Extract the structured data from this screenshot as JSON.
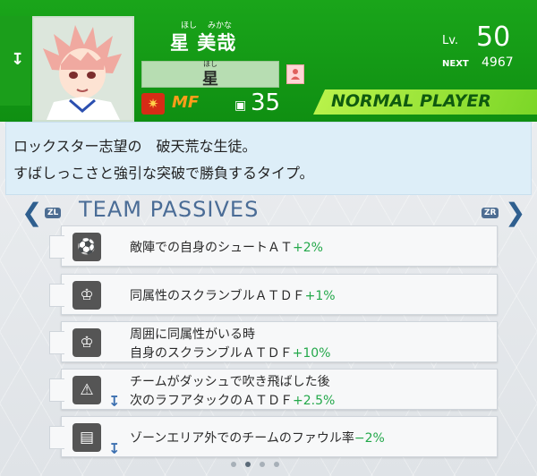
{
  "player": {
    "name": "星 美哉",
    "name_furigana_left": "ほし",
    "name_furigana_right": "みかな",
    "nickname": "星",
    "nickname_furigana": "ほし",
    "position": "MF",
    "power": "35",
    "level_label": "Lv.",
    "level": "50",
    "next_label": "NEXT",
    "next_exp": "4967",
    "rank": "NORMAL PLAYER"
  },
  "description": {
    "line1": "ロックスター志望の　破天荒な生徒。",
    "line2": "すばしっこさと強引な突破で勝負するタイプ。"
  },
  "team_passives": {
    "title": "TEAM PASSIVES",
    "left_button": "ZL",
    "right_button": "ZR",
    "items": [
      {
        "icon": "soccer-shoot-icon",
        "text": "敵陣での自身のシュートＡＴ",
        "value": "+2%",
        "secondary": ""
      },
      {
        "icon": "scramble-icon",
        "text": "同属性のスクランブルＡＴＤＦ",
        "value": "+1%",
        "secondary": ""
      },
      {
        "icon": "scramble-icon",
        "text": "周囲に同属性がいる時",
        "secondary": "自身のスクランブルＡＴＤＦ",
        "value": "+10%"
      },
      {
        "icon": "warning-icon",
        "text": "チームがダッシュで吹き飛ばした後",
        "secondary": "次のラフアタックのＡＴＤＦ",
        "value": "+2.5%"
      },
      {
        "icon": "foul-card-icon",
        "text": "ゾーンエリア外でのチームのファウル率",
        "value": "−2%",
        "secondary": ""
      }
    ]
  },
  "pagination": {
    "total": 4,
    "active_index": 1
  },
  "colors": {
    "header_green": "#14a016",
    "rank_green": "#8ee03a",
    "value_green": "#23a84a"
  }
}
